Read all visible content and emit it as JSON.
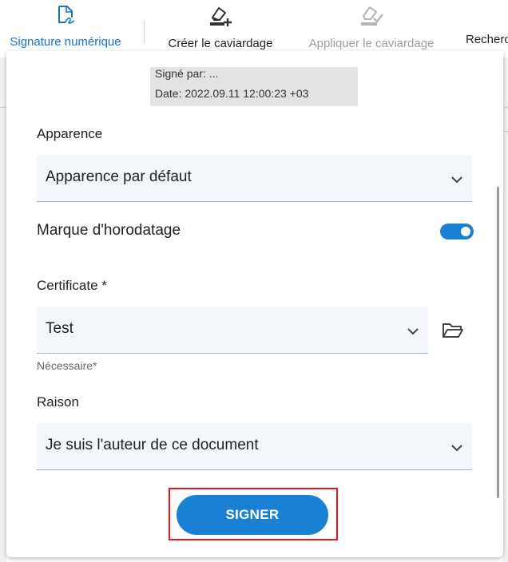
{
  "toolbar": {
    "items": [
      {
        "label": "Signature numérique",
        "icon": "signature-icon",
        "state": "active"
      },
      {
        "label": "Créer le caviardage",
        "icon": "create-redaction-icon",
        "state": "normal"
      },
      {
        "label": "Appliquer le caviardage",
        "icon": "apply-redaction-icon",
        "state": "disabled"
      },
      {
        "label": "Recherc",
        "icon": "",
        "state": "normal"
      }
    ]
  },
  "preview": {
    "signed_by": "Signé par: ...",
    "date": "Date: 2022.09.11 12:00:23 +03"
  },
  "form": {
    "appearance": {
      "label": "Apparence",
      "value": "Apparence par défaut"
    },
    "timestamp": {
      "label": "Marque d'horodatage",
      "enabled": true
    },
    "certificate": {
      "label": "Certificate *",
      "value": "Test",
      "helper": "Nécessaire*",
      "browse_icon": "folder-open-icon"
    },
    "reason": {
      "label": "Raison",
      "value": "Je suis l'auteur de ce document"
    }
  },
  "sign_button": {
    "label": "SIGNER",
    "highlighted": true
  },
  "colors": {
    "accent": "#1a80d4",
    "highlight": "#e8141c",
    "disabled": "#9e9e9e"
  }
}
